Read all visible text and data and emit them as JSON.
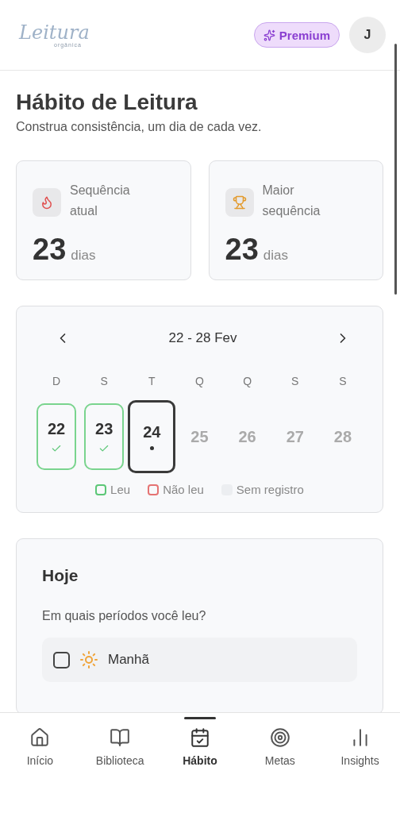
{
  "header": {
    "logo": {
      "name": "Leitura",
      "tagline": "orgânica"
    },
    "premium": "Premium",
    "avatar": "J"
  },
  "page": {
    "title": "Hábito de Leitura",
    "subtitle": "Construa consistência, um dia de cada vez."
  },
  "stats": [
    {
      "kind": "flame",
      "label": "Sequência atual",
      "value": "23",
      "unit": "dias"
    },
    {
      "kind": "trophy",
      "label": "Maior sequência",
      "value": "23",
      "unit": "dias"
    }
  ],
  "week": {
    "range": "22 - 28 Fev",
    "days": [
      {
        "weekday": "D",
        "date": "22",
        "kind": "read"
      },
      {
        "weekday": "S",
        "date": "23",
        "kind": "read"
      },
      {
        "weekday": "T",
        "date": "24",
        "kind": "today"
      },
      {
        "weekday": "Q",
        "date": "25",
        "kind": "future"
      },
      {
        "weekday": "Q",
        "date": "26",
        "kind": "future"
      },
      {
        "weekday": "S",
        "date": "27",
        "kind": "future"
      },
      {
        "weekday": "S",
        "date": "28",
        "kind": "future"
      }
    ],
    "legend": [
      {
        "label": "Leu",
        "color": "#5cc777"
      },
      {
        "label": "Não leu",
        "color": "#e57373"
      },
      {
        "label": "Sem registro",
        "color": "#eceef1"
      }
    ]
  },
  "today": {
    "title": "Hoje",
    "question": "Em quais períodos você leu?",
    "periods": [
      {
        "kind": "sun",
        "label": "Manhã",
        "checked": false
      }
    ]
  },
  "nav": [
    {
      "kind": "home",
      "label": "Início",
      "selected": false
    },
    {
      "kind": "book",
      "label": "Biblioteca",
      "selected": false
    },
    {
      "kind": "calendar",
      "label": "Hábito",
      "selected": true
    },
    {
      "kind": "target",
      "label": "Metas",
      "selected": false
    },
    {
      "kind": "chart",
      "label": "Insights",
      "selected": false
    }
  ]
}
